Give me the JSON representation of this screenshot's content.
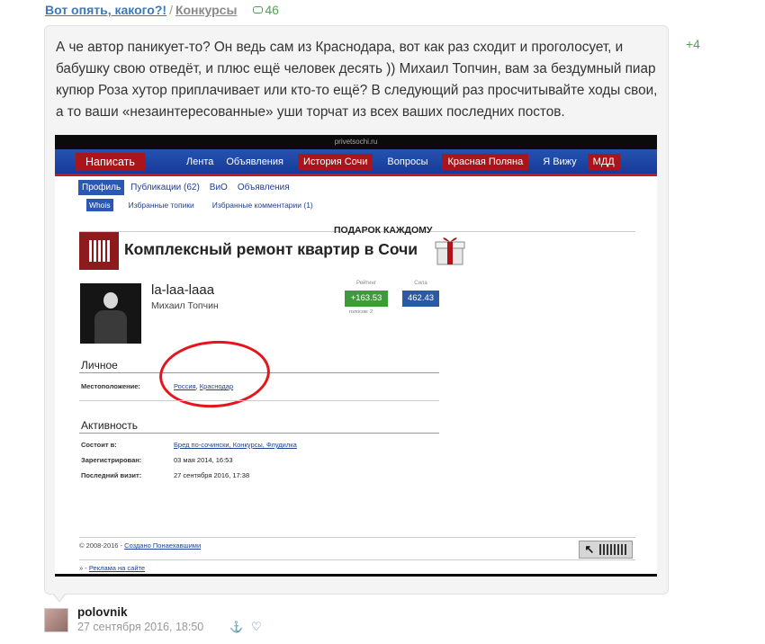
{
  "post": {
    "title": "Вот опять, какого?!",
    "separator": "/",
    "category": "Конкурсы",
    "comments_count": "46"
  },
  "comment": {
    "text": "А че автор паникует-то? Он ведь сам из Краснодара, вот как раз сходит и проголосует, и бабушку свою отведёт, и плюс ещё человек десять )) Михаил Топчин, вам за бездумный пиар купюр Роза хутор приплачивает или кто-то ещё? В следующий раз просчитывайте ходы свои, а то ваши «незаинтересованные» уши торчат из всех ваших последних постов.",
    "rating": "+4"
  },
  "screenshot": {
    "site": "privetsochi.ru",
    "write_button": "Написать",
    "nav": [
      {
        "label": "Лента",
        "highlight": false
      },
      {
        "label": "Объявления",
        "highlight": false
      },
      {
        "label": "История Сочи",
        "highlight": true
      },
      {
        "label": "Вопросы",
        "highlight": false
      },
      {
        "label": "Красная Поляна",
        "highlight": true
      },
      {
        "label": "Я Вижу",
        "highlight": false
      },
      {
        "label": "МДД",
        "highlight": true
      }
    ],
    "tabs": [
      "Профиль",
      "Публикации (62)",
      "ВиО",
      "Объявления"
    ],
    "subtabs": [
      "Whois",
      "Избранные топики",
      "Избранные комментарии (1)"
    ],
    "banner": {
      "text": "Комплексный ремонт квартир в Сочи",
      "gift_label": "ПОДАРОК КАЖДОМУ"
    },
    "profile": {
      "username": "la-laa-laaa",
      "full_name": "Михаил Топчин",
      "rating_label": "Рейтинг",
      "rating_value": "+163.53",
      "votes": "голосов: 2",
      "power_label": "Сила",
      "power_value": "462.43"
    },
    "personal": {
      "heading": "Личное",
      "location_label": "Местоположение:",
      "country": "Россия",
      "comma": ",",
      "city": "Краснодар"
    },
    "activity": {
      "heading": "Активность",
      "member_label": "Состоит в:",
      "member_value": "Бред по-сочински, Конкурсы, Флудилка",
      "registered_label": "Зарегистрирован:",
      "registered_value": "03 мая 2014, 16:53",
      "last_visit_label": "Последний визит:",
      "last_visit_value": "27 сентября 2016, 17:38"
    },
    "footer": {
      "copyright": "© 2008-2016 -",
      "created_by": "Создано Понаехавшими",
      "ad_prefix": "» -",
      "ad_link": "Реклама на сайте"
    }
  },
  "author": {
    "name": "polovnik",
    "date": "27 сентября 2016, 18:50"
  },
  "colors": {
    "link": "#3b7ab8",
    "positive": "#4aa84a",
    "nav_blue": "#2453b0",
    "nav_red": "#a8161b",
    "oval_red": "#e4161b"
  },
  "icons": {
    "comments": "comment-bubble-icon",
    "anchor": "anchor-icon",
    "favorite": "heart-icon"
  }
}
